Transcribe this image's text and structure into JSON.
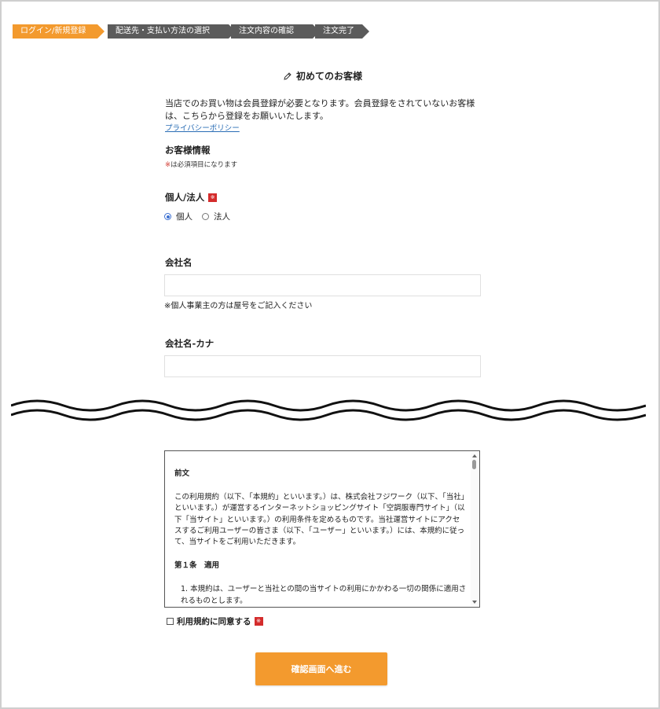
{
  "steps": [
    {
      "label": "ログイン/新規登録",
      "active": true
    },
    {
      "label": "配送先・支払い方法の選択",
      "active": false
    },
    {
      "label": "注文内容の確認",
      "active": false
    },
    {
      "label": "注文完了",
      "active": false
    }
  ],
  "page_title": "初めてのお客様",
  "intro": "当店でのお買い物は会員登録が必要となります。会員登録をされていないお客様は、こちらから登録をお願いいたします。",
  "privacy_link": "プライバシーポリシー",
  "customer_info": {
    "heading": "お客様情報",
    "required_mark": "※",
    "required_note": "は必須項目になります"
  },
  "required_badge": "※",
  "person_type": {
    "label": "個人/法人",
    "options": [
      "個人",
      "法人"
    ],
    "selected": "個人"
  },
  "company_name": {
    "label": "会社名",
    "value": "",
    "hint": "※個人事業主の方は屋号をご記入ください"
  },
  "company_kana": {
    "label": "会社名-カナ",
    "value": ""
  },
  "terms": {
    "heading": "前文",
    "body": "この利用規約（以下、「本規約」といいます。）は、株式会社フジワーク（以下、「当社」といいます。）が運営するインターネットショッピングサイト「空調服専門サイト」（以下「当サイト」といいます。）の利用条件を定めるものです。当社運営サイトにアクセスするご利用ユーザーの皆さま（以下、「ユーザー」といいます。）には、本規約に従って、当サイトをご利用いただきます。",
    "article_title": "第１条　適用",
    "item_1": "1. 本規約は、ユーザーと当社との間の当サイトの利用にかかわる一切の関係に適用されるものとします。"
  },
  "agree_label": "利用規約に同意する",
  "submit_label": "確認画面へ進む",
  "colors": {
    "accent": "#f39a2e",
    "step_inactive": "#5b5b5b",
    "required": "#d42c2c",
    "link": "#2a6db5"
  }
}
